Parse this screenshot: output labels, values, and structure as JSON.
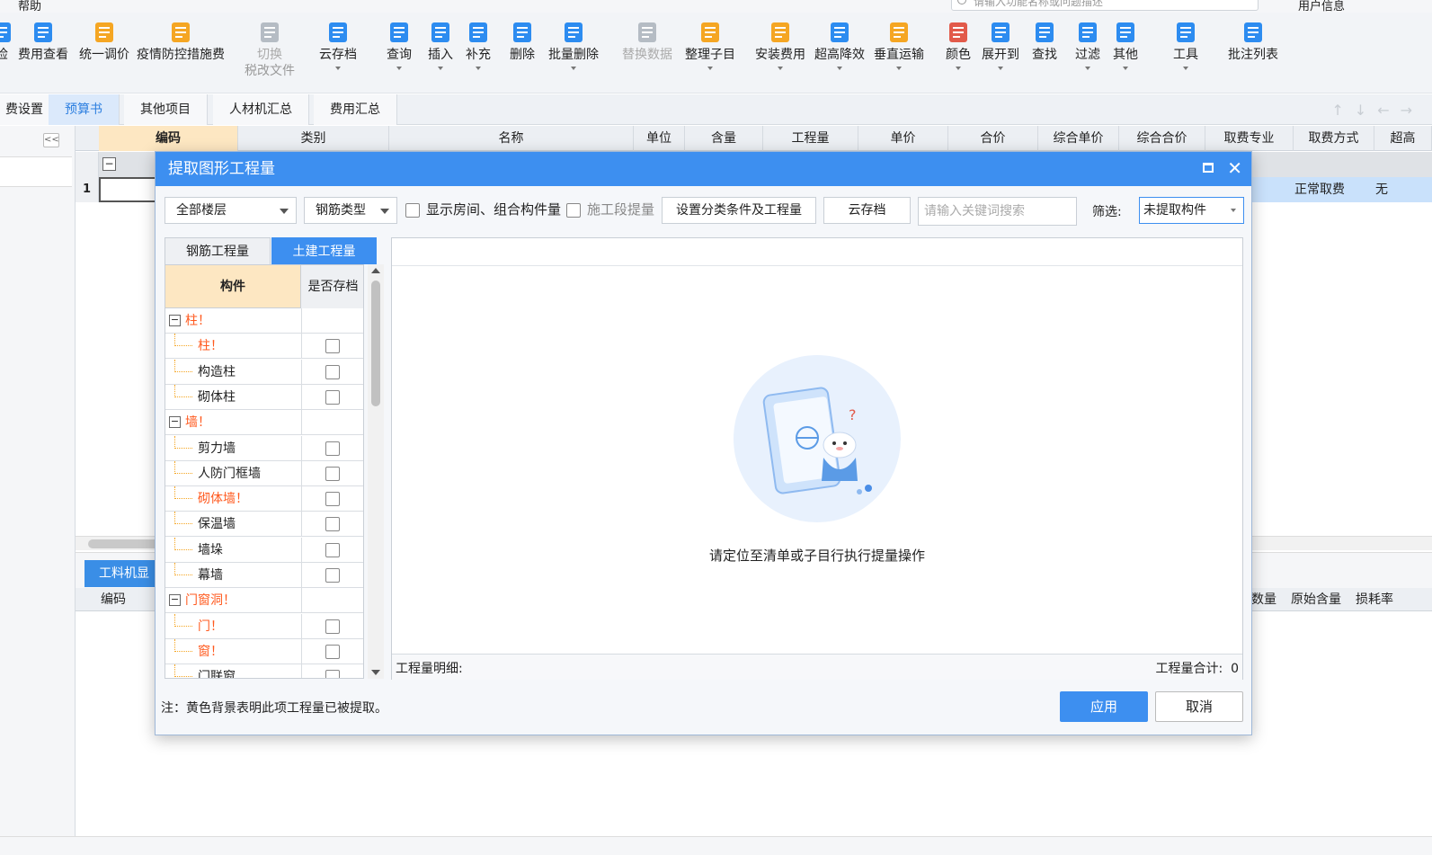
{
  "menubar": {
    "help": "帮助",
    "search_placeholder": "请输入功能名称或问题描述",
    "user_info": "用户信息"
  },
  "toolbar": {
    "items": [
      {
        "label": "检",
        "icon": "check-icon"
      },
      {
        "label": "费用查看",
        "icon": "fee-view-icon"
      },
      {
        "label": "统一调价",
        "icon": "price-adjust-icon"
      },
      {
        "label": "疫情防控措施费",
        "icon": "epidemic-fee-icon"
      },
      {
        "label": "切换",
        "sub": "税改文件",
        "icon": "switch-tax-icon"
      },
      {
        "label": "云存档",
        "icon": "cloud-archive-icon"
      },
      {
        "label": "查询",
        "icon": "query-icon"
      },
      {
        "label": "插入",
        "icon": "insert-icon"
      },
      {
        "label": "补充",
        "icon": "supplement-icon"
      },
      {
        "label": "删除",
        "icon": "delete-icon"
      },
      {
        "label": "批量删除",
        "icon": "batch-delete-icon"
      },
      {
        "label": "替换数据",
        "icon": "replace-data-icon"
      },
      {
        "label": "整理子目",
        "icon": "organize-items-icon"
      },
      {
        "label": "安装费用",
        "icon": "install-fee-icon"
      },
      {
        "label": "超高降效",
        "icon": "overheight-icon"
      },
      {
        "label": "垂直运输",
        "icon": "vertical-transport-icon"
      },
      {
        "label": "颜色",
        "icon": "color-icon"
      },
      {
        "label": "展开到",
        "icon": "expand-to-icon"
      },
      {
        "label": "查找",
        "icon": "find-icon"
      },
      {
        "label": "过滤",
        "icon": "filter-icon"
      },
      {
        "label": "其他",
        "icon": "other-icon"
      },
      {
        "label": "工具",
        "icon": "tools-icon"
      },
      {
        "label": "批注列表",
        "icon": "annotation-list-icon"
      }
    ]
  },
  "tabs": {
    "items": [
      "费设置",
      "预算书",
      "其他项目",
      "人材机汇总",
      "费用汇总"
    ],
    "active": "预算书"
  },
  "grid": {
    "columns": [
      "编码",
      "类别",
      "名称",
      "单位",
      "含量",
      "工程量",
      "单价",
      "合价",
      "综合单价",
      "综合合价",
      "取费专业",
      "取费方式",
      "超高"
    ],
    "row1_num": "1",
    "row1_fee_method": "正常取费",
    "row1_overheight": "无"
  },
  "lower": {
    "tab": "工料机显",
    "col_code": "编码",
    "col_qty": "数量",
    "col_orig": "原始含量",
    "col_loss": "损耗率"
  },
  "dialog": {
    "title": "提取图形工程量",
    "floor_select": "全部楼层",
    "rebar_type_select": "钢筋类型",
    "show_rooms_label": "显示房间、组合构件量",
    "construction_stage_label": "施工段提量",
    "set_conditions_button": "设置分类条件及工程量",
    "cloud_archive_button": "云存档",
    "keyword_placeholder": "请输入关键词搜索",
    "filter_label": "筛选:",
    "filter_value": "未提取构件",
    "subtabs": [
      "钢筋工程量",
      "土建工程量"
    ],
    "active_subtab": "土建工程量",
    "tree_header_component": "构件",
    "tree_header_archived": "是否存档",
    "tree_rows": [
      {
        "name": "柱！",
        "level": 0,
        "red": true
      },
      {
        "name": "柱！",
        "level": 1,
        "red": true
      },
      {
        "name": "构造柱",
        "level": 1,
        "red": false
      },
      {
        "name": "砌体柱",
        "level": 1,
        "red": false
      },
      {
        "name": "墙！",
        "level": 0,
        "red": true
      },
      {
        "name": "剪力墙",
        "level": 1,
        "red": false
      },
      {
        "name": "人防门框墙",
        "level": 1,
        "red": false
      },
      {
        "name": "砌体墙！",
        "level": 1,
        "red": true
      },
      {
        "name": "保温墙",
        "level": 1,
        "red": false
      },
      {
        "name": "墙垛",
        "level": 1,
        "red": false
      },
      {
        "name": "幕墙",
        "level": 1,
        "red": false
      },
      {
        "name": "门窗洞！",
        "level": 0,
        "red": true
      },
      {
        "name": "门！",
        "level": 1,
        "red": true
      },
      {
        "name": "窗！",
        "level": 1,
        "red": true
      },
      {
        "name": "门联窗",
        "level": 1,
        "red": false
      }
    ],
    "empty_message": "请定位至清单或子目行执行提量操作",
    "detail_label": "工程量明细:",
    "total_label": "工程量合计:",
    "total_value": "0",
    "note": "注：黄色背景表明此项工程量已被提取。",
    "apply_button": "应用",
    "cancel_button": "取消"
  },
  "colors": {
    "accent": "#3d8ff0",
    "highlight": "#fde7c2",
    "warning_text": "#ff5a1f"
  }
}
